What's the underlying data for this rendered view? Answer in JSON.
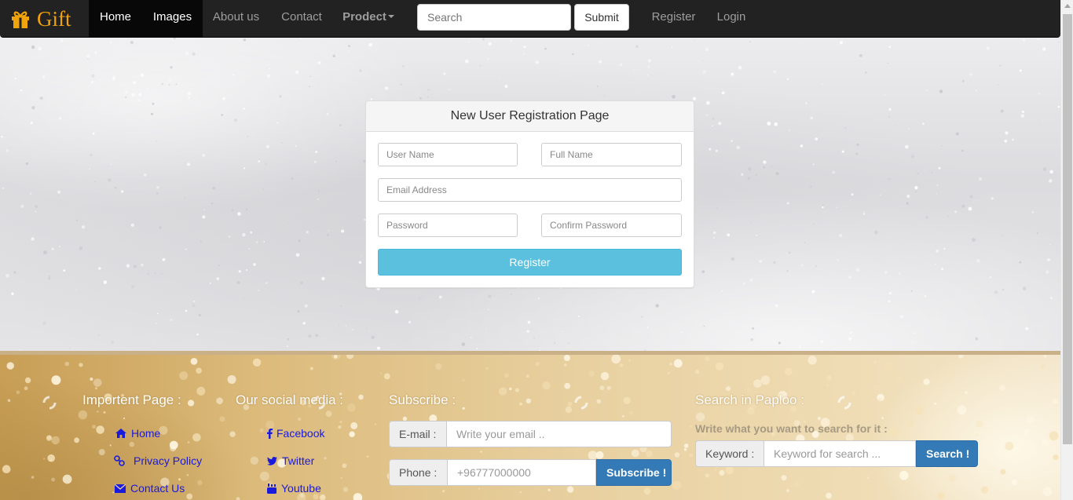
{
  "navbar": {
    "brand": "Gift",
    "items": [
      {
        "label": "Home",
        "active": true
      },
      {
        "label": "Images",
        "active": true
      },
      {
        "label": "About us"
      },
      {
        "label": "Contact"
      },
      {
        "label": "Prodect",
        "dropdown": true
      }
    ],
    "search_placeholder": "Search",
    "submit_label": "Submit",
    "register_label": "Register",
    "login_label": "Login"
  },
  "registration": {
    "title": "New User Registration Page",
    "username_placeholder": "User Name",
    "fullname_placeholder": "Full Name",
    "email_placeholder": "Email Address",
    "password_placeholder": "Password",
    "confirm_placeholder": "Confirm Password",
    "register_label": "Register"
  },
  "footer": {
    "pages": {
      "title": "Importent Page :",
      "links": [
        {
          "label": "Home",
          "icon": "home-icon"
        },
        {
          "label": "Privacy Policy",
          "icon": "link-icon"
        },
        {
          "label": "Contact Us",
          "icon": "envelope-icon"
        }
      ]
    },
    "social": {
      "title": "Our social media :",
      "links": [
        {
          "label": "Facebook",
          "icon": "facebook-icon"
        },
        {
          "label": "Twitter",
          "icon": "twitter-icon"
        },
        {
          "label": "Youtube",
          "icon": "youtube-icon"
        }
      ]
    },
    "subscribe": {
      "title": "Subscribe :",
      "email_addon": "E-mail :",
      "email_placeholder": "Write your email ..",
      "phone_addon": "Phone :",
      "phone_placeholder": "+96777000000",
      "button": "Subscribe !"
    },
    "search": {
      "title": "Search in Paploo :",
      "hint": "Write what you want to search for it :",
      "keyword_addon": "Keyword :",
      "keyword_placeholder": "Keyword for search ...",
      "button": "Search !"
    }
  },
  "colors": {
    "navbar_bg": "#222222",
    "brand": "#f0a30a",
    "register_button": "#5bc0de",
    "primary_button": "#337ab7",
    "footer_link": "#1a1adc"
  }
}
